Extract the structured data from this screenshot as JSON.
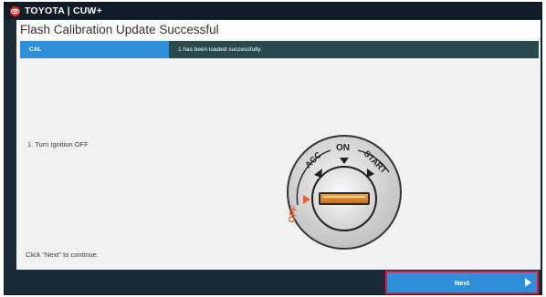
{
  "brand": {
    "text": "TOYOTA | CUW+"
  },
  "page": {
    "title": "Flash Calibration Update Successful"
  },
  "cal_row": {
    "label": "CAL",
    "value": "1 has been loaded successfully."
  },
  "instructions": {
    "step": "1. Turn Ignition OFF",
    "continue": "Click \"Next\" to continue."
  },
  "ignition": {
    "positions": {
      "off": "OFF",
      "acc": "ACC",
      "on": "ON",
      "start": "START"
    },
    "current_position": "OFF"
  },
  "footer": {
    "next_label": "Next"
  },
  "colors": {
    "brand_red": "#e3232a",
    "cal_label_bg": "#2f8fd6",
    "cal_value_bg": "#284a4c",
    "next_bg": "#2f8fd6",
    "highlight_border": "#d6202c",
    "off_accent": "#e8632a"
  }
}
